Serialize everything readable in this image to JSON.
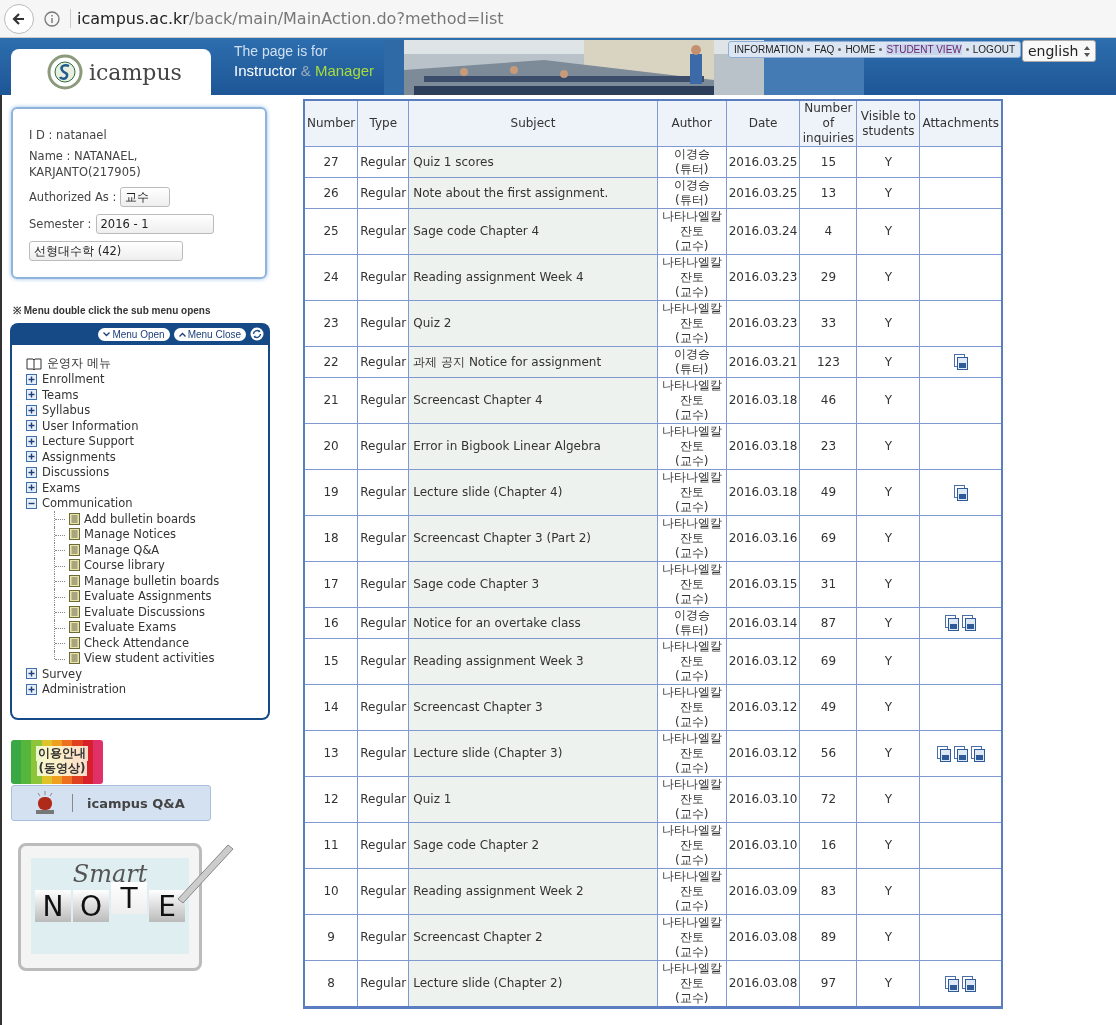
{
  "browser": {
    "host": "icampus.ac.kr",
    "path": "/back/main/MainAction.do?method=list"
  },
  "header": {
    "logo_text": "icampus",
    "tagline": "The page is for",
    "role_1": "Instructor",
    "role_sep": "&",
    "role_2": "Manager",
    "nav": [
      {
        "label": "INFORMATION",
        "selected": false
      },
      {
        "label": "FAQ",
        "selected": false
      },
      {
        "label": "HOME",
        "selected": false
      },
      {
        "label": "STUDENT VIEW",
        "selected": true
      },
      {
        "label": "LOGOUT",
        "selected": false
      }
    ],
    "language": "english"
  },
  "profile": {
    "id_label": "I D :",
    "id": "natanael",
    "name_label": "Name :",
    "name": "NATANAEL, KARJANTO(217905)",
    "role_label": "Authorized As :",
    "role": "교수",
    "semester_label": "Semester :",
    "semester": "2016 - 1",
    "course": "선형대수학 (42)"
  },
  "menu_note": "※ Menu double click the sub menu opens",
  "menu": {
    "open_label": "Menu Open",
    "close_label": "Menu Close",
    "root": "운영자 메뉴",
    "items": [
      {
        "label": "Enrollment",
        "expanded": false
      },
      {
        "label": "Teams",
        "expanded": false
      },
      {
        "label": "Syllabus",
        "expanded": false
      },
      {
        "label": "User Information",
        "expanded": false
      },
      {
        "label": "Lecture Support",
        "expanded": false
      },
      {
        "label": "Assignments",
        "expanded": false
      },
      {
        "label": "Discussions",
        "expanded": false
      },
      {
        "label": "Exams",
        "expanded": false
      },
      {
        "label": "Communication",
        "expanded": true,
        "children": [
          {
            "label": "Add bulletin boards"
          },
          {
            "label": "Manage Notices"
          },
          {
            "label": "Manage Q&A"
          },
          {
            "label": "Course library"
          },
          {
            "label": "Manage bulletin boards"
          },
          {
            "label": "Evaluate Assignments"
          },
          {
            "label": "Evaluate Discussions"
          },
          {
            "label": "Evaluate Exams"
          },
          {
            "label": "Check Attendance"
          },
          {
            "label": "View student activities"
          }
        ]
      },
      {
        "label": "Survey",
        "expanded": false
      },
      {
        "label": "Administration",
        "expanded": false
      }
    ]
  },
  "guide_banner": [
    "이용안내",
    "(동영상)"
  ],
  "qa_button": "icampus Q&A",
  "smart_note": {
    "script": "Smart",
    "letters": [
      "N",
      "O",
      "T",
      "E"
    ]
  },
  "table": {
    "columns": [
      "Number",
      "Type",
      "Subject",
      "Author",
      "Date",
      "Number of inquiries",
      "Visible to students",
      "Attachments"
    ],
    "rows": [
      {
        "number": "27",
        "type": "Regular",
        "subject": "Quiz 1 scores",
        "author": [
          "이경승",
          "(튜터)"
        ],
        "date": "2016.03.25",
        "inquiries": "15",
        "visible": "Y"
      },
      {
        "number": "26",
        "type": "Regular",
        "subject": "Note about the first assignment.",
        "author": [
          "이경승",
          "(튜터)"
        ],
        "date": "2016.03.25",
        "inquiries": "13",
        "visible": "Y"
      },
      {
        "number": "25",
        "type": "Regular",
        "subject": "Sage code Chapter 4",
        "author": [
          "나타나엘칼",
          "잔토",
          "(교수)"
        ],
        "date": "2016.03.24",
        "inquiries": "4",
        "visible": "Y"
      },
      {
        "number": "24",
        "type": "Regular",
        "subject": "Reading assignment Week 4",
        "author": [
          "나타나엘칼",
          "잔토",
          "(교수)"
        ],
        "date": "2016.03.23",
        "inquiries": "29",
        "visible": "Y"
      },
      {
        "number": "23",
        "type": "Regular",
        "subject": "Quiz 2",
        "author": [
          "나타나엘칼",
          "잔토",
          "(교수)"
        ],
        "date": "2016.03.23",
        "inquiries": "33",
        "visible": "Y"
      },
      {
        "number": "22",
        "type": "Regular",
        "subject": "과제 공지 Notice for assignment",
        "author": [
          "이경승",
          "(튜터)"
        ],
        "date": "2016.03.21",
        "inquiries": "123",
        "visible": "Y",
        "attachments": [
          {
            "kind": "file"
          }
        ]
      },
      {
        "number": "21",
        "type": "Regular",
        "subject": "Screencast Chapter 4",
        "author": [
          "나타나엘칼",
          "잔토",
          "(교수)"
        ],
        "date": "2016.03.18",
        "inquiries": "46",
        "visible": "Y"
      },
      {
        "number": "20",
        "type": "Regular",
        "subject": "Error in Bigbook Linear Algebra",
        "author": [
          "나타나엘칼",
          "잔토",
          "(교수)"
        ],
        "date": "2016.03.18",
        "inquiries": "23",
        "visible": "Y"
      },
      {
        "number": "19",
        "type": "Regular",
        "subject": "Lecture slide (Chapter 4)",
        "author": [
          "나타나엘칼",
          "잔토",
          "(교수)"
        ],
        "date": "2016.03.18",
        "inquiries": "49",
        "visible": "Y",
        "attachments": [
          {
            "kind": "file"
          }
        ]
      },
      {
        "number": "18",
        "type": "Regular",
        "subject": "Screencast Chapter 3 (Part 2)",
        "author": [
          "나타나엘칼",
          "잔토",
          "(교수)"
        ],
        "date": "2016.03.16",
        "inquiries": "69",
        "visible": "Y"
      },
      {
        "number": "17",
        "type": "Regular",
        "subject": "Sage code Chapter 3",
        "author": [
          "나타나엘칼",
          "잔토",
          "(교수)"
        ],
        "date": "2016.03.15",
        "inquiries": "31",
        "visible": "Y"
      },
      {
        "number": "16",
        "type": "Regular",
        "subject": "Notice for an overtake class",
        "author": [
          "이경승",
          "(튜터)"
        ],
        "date": "2016.03.14",
        "inquiries": "87",
        "visible": "Y",
        "attachments": [
          {
            "kind": "file"
          },
          {
            "kind": "file"
          }
        ]
      },
      {
        "number": "15",
        "type": "Regular",
        "subject": "Reading assignment Week 3",
        "author": [
          "나타나엘칼",
          "잔토",
          "(교수)"
        ],
        "date": "2016.03.12",
        "inquiries": "69",
        "visible": "Y"
      },
      {
        "number": "14",
        "type": "Regular",
        "subject": "Screencast Chapter 3",
        "author": [
          "나타나엘칼",
          "잔토",
          "(교수)"
        ],
        "date": "2016.03.12",
        "inquiries": "49",
        "visible": "Y"
      },
      {
        "number": "13",
        "type": "Regular",
        "subject": "Lecture slide (Chapter 3)",
        "author": [
          "나타나엘칼",
          "잔토",
          "(교수)"
        ],
        "date": "2016.03.12",
        "inquiries": "56",
        "visible": "Y",
        "attachments": [
          {
            "kind": "file"
          },
          {
            "kind": "file"
          },
          {
            "kind": "file"
          }
        ]
      },
      {
        "number": "12",
        "type": "Regular",
        "subject": "Quiz 1",
        "author": [
          "나타나엘칼",
          "잔토",
          "(교수)"
        ],
        "date": "2016.03.10",
        "inquiries": "72",
        "visible": "Y"
      },
      {
        "number": "11",
        "type": "Regular",
        "subject": "Sage code Chapter 2",
        "author": [
          "나타나엘칼",
          "잔토",
          "(교수)"
        ],
        "date": "2016.03.10",
        "inquiries": "16",
        "visible": "Y"
      },
      {
        "number": "10",
        "type": "Regular",
        "subject": "Reading assignment Week 2",
        "author": [
          "나타나엘칼",
          "잔토",
          "(교수)"
        ],
        "date": "2016.03.09",
        "inquiries": "83",
        "visible": "Y"
      },
      {
        "number": "9",
        "type": "Regular",
        "subject": "Screencast Chapter 2",
        "author": [
          "나타나엘칼",
          "잔토",
          "(교수)"
        ],
        "date": "2016.03.08",
        "inquiries": "89",
        "visible": "Y"
      },
      {
        "number": "8",
        "type": "Regular",
        "subject": "Lecture slide (Chapter 2)",
        "author": [
          "나타나엘칼",
          "잔토",
          "(교수)"
        ],
        "date": "2016.03.08",
        "inquiries": "97",
        "visible": "Y",
        "attachments": [
          {
            "kind": "file"
          },
          {
            "kind": "file"
          }
        ]
      }
    ]
  }
}
